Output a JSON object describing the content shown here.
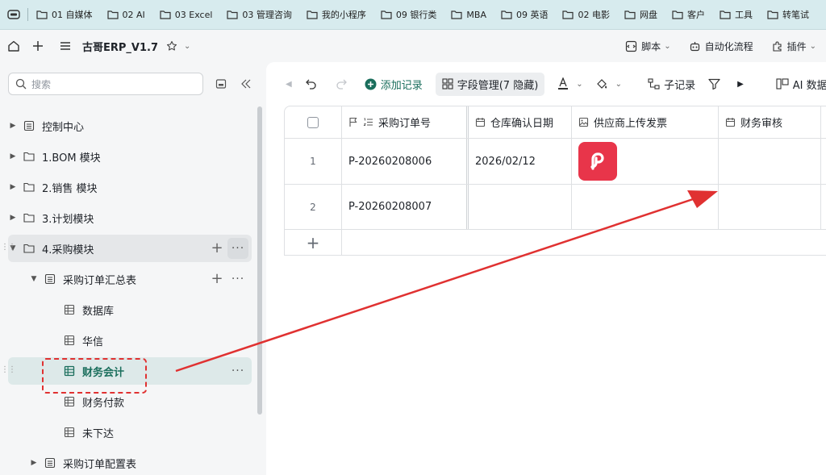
{
  "bookmarks": [
    "01 自媒体",
    "02 AI",
    "03 Excel",
    "03 管理咨询",
    "我的小程序",
    "09 银行类",
    "MBA",
    "09 英语",
    "02 电影",
    "网盘",
    "客户",
    "工具",
    "转笔试"
  ],
  "app": {
    "title": "古哥ERP_V1.7",
    "script_label": "脚本",
    "automation_label": "自动化流程",
    "plugin_label": "插件"
  },
  "sidebar": {
    "search_placeholder": "搜索",
    "items": [
      {
        "label": "控制中心"
      },
      {
        "label": "1.BOM 模块"
      },
      {
        "label": "2.销售 模块"
      },
      {
        "label": "3.计划模块"
      },
      {
        "label": "4.采购模块"
      },
      {
        "label": "采购订单汇总表"
      },
      {
        "label": "数据库"
      },
      {
        "label": "华信"
      },
      {
        "label": "财务会计"
      },
      {
        "label": "财务付款"
      },
      {
        "label": "未下达"
      },
      {
        "label": "采购订单配置表"
      }
    ]
  },
  "toolbar": {
    "add_record": "添加记录",
    "field_manage": "字段管理(7 隐藏)",
    "sub_record": "子记录",
    "ai_label": "AI 数据"
  },
  "table": {
    "columns": [
      "采购订单号",
      "仓库确认日期",
      "供应商上传发票",
      "财务审核"
    ],
    "rows": [
      {
        "index": "1",
        "order_no": "P-20260208006",
        "confirm_date": "2026/02/12",
        "invoice": "attachment",
        "audit": ""
      },
      {
        "index": "2",
        "order_no": "P-20260208007",
        "confirm_date": "",
        "invoice": "",
        "audit": ""
      }
    ],
    "add_row": "+"
  },
  "colors": {
    "accent": "#1a6e5c",
    "annotation": "#e03131",
    "attachment": "#e8354a"
  }
}
